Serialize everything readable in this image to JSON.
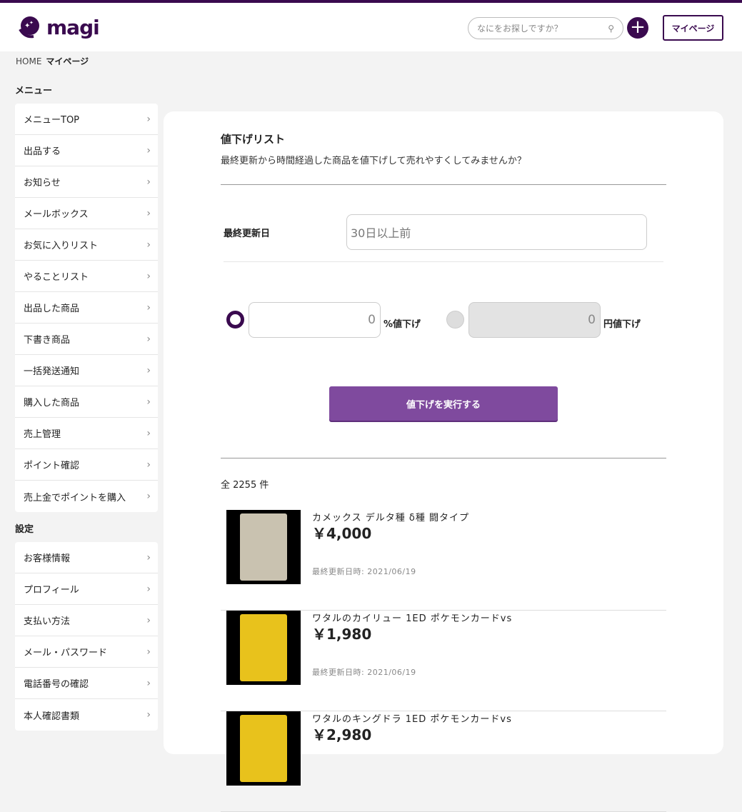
{
  "header": {
    "logo": "magi",
    "search_placeholder": "なにをお探しですか？",
    "mypage": "マイページ"
  },
  "breadcrumb": {
    "home": "HOME",
    "current": "マイページ"
  },
  "menu": {
    "title": "メニュー",
    "items": [
      "メニューTOP",
      "出品する",
      "お知らせ",
      "メールボックス",
      "お気に入りリスト",
      "やることリスト",
      "出品した商品",
      "下書き商品",
      "一括発送通知",
      "購入した商品",
      "売上管理",
      "ポイント確認",
      "売上金でポイントを購入"
    ]
  },
  "settings": {
    "title": "設定",
    "items": [
      "お客様情報",
      "プロフィール",
      "支払い方法",
      "メール・パスワード",
      "電話番号の確認",
      "本人確認書類"
    ]
  },
  "main": {
    "title": "値下げリスト",
    "subtitle": "最終更新から時間経過した商品を値下げして売れやすくしてみませんか？",
    "last_updated_label": "最終更新日",
    "last_updated_value": "30日以上前",
    "percent_value": "0",
    "percent_label": "%値下げ",
    "yen_value": "0",
    "yen_label": "円値下げ",
    "execute": "値下げを実行する",
    "count": "全 2255 件"
  },
  "items": [
    {
      "name": "カメックス デルタ種 δ種 闘タイプ",
      "price": "￥4,000",
      "date": "最終更新日時: 2021/06/19",
      "color": "#c9c2b0"
    },
    {
      "name": "ワタルのカイリュー 1ED ポケモンカードvs",
      "price": "￥1,980",
      "date": "最終更新日時: 2021/06/19",
      "color": "#e8c21c"
    },
    {
      "name": "ワタルのキングドラ 1ED ポケモンカードvs",
      "price": "￥2,980",
      "date": "",
      "color": "#e8c21c"
    }
  ]
}
